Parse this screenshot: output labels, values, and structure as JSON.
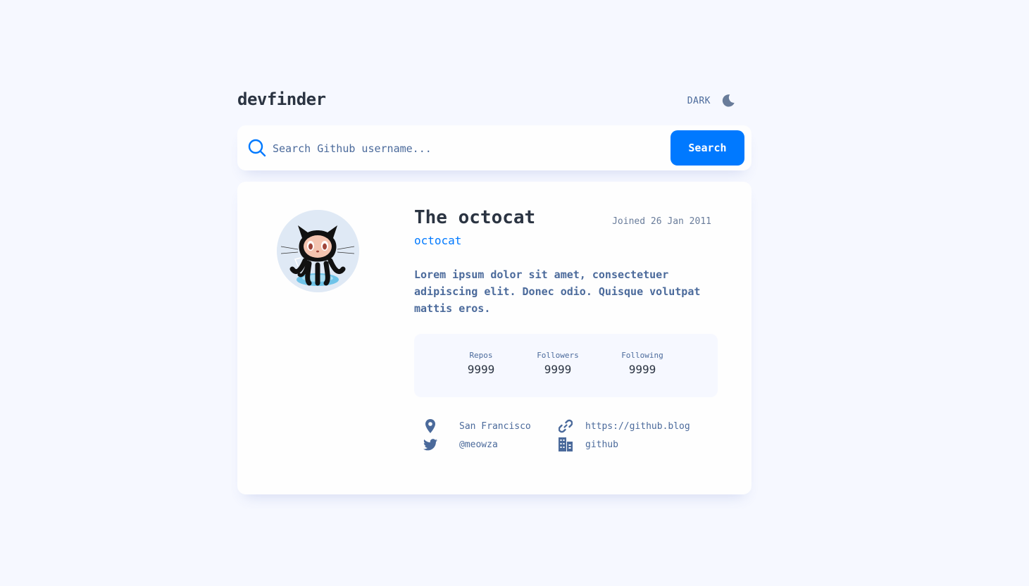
{
  "app": {
    "title": "devfinder",
    "theme_toggle_label": "DARK",
    "theme_icon": "moon-icon"
  },
  "search": {
    "placeholder": "Search Github username...",
    "value": "",
    "button_label": "Search",
    "icon": "search-icon"
  },
  "profile": {
    "name": "The octocat",
    "login": "octocat",
    "joined": "Joined 26 Jan 2011",
    "bio": "Lorem ipsum dolor sit amet, consectetuer adipiscing elit. Donec odio. Quisque volutpat mattis eros.",
    "avatar_icon": "octocat-avatar"
  },
  "stats": [
    {
      "label": "Repos",
      "value": "9999"
    },
    {
      "label": "Followers",
      "value": "9999"
    },
    {
      "label": "Following",
      "value": "9999"
    }
  ],
  "links": {
    "location": {
      "icon": "location-pin-icon",
      "text": "San Francisco"
    },
    "blog": {
      "icon": "link-icon",
      "text": "https://github.blog"
    },
    "twitter": {
      "icon": "twitter-icon",
      "text": "@meowza"
    },
    "company": {
      "icon": "building-icon",
      "text": "github"
    }
  },
  "colors": {
    "background": "#f6f8ff",
    "card": "#fefefe",
    "accent": "#0079ff",
    "heading": "#2b3442",
    "text": "#4b6a9b"
  }
}
